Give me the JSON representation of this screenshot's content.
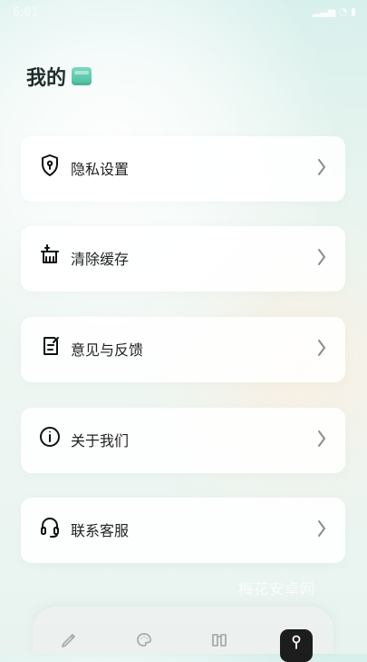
{
  "status_bar": {
    "left_text": "6:01",
    "right_icons": [
      "signal-icon",
      "wifi-icon",
      "battery-icon"
    ]
  },
  "header": {
    "title": "我的"
  },
  "menu": {
    "items": [
      {
        "label": "隐私设置",
        "icon": "shield-icon"
      },
      {
        "label": "清除缓存",
        "icon": "broom-icon"
      },
      {
        "label": "意见与反馈",
        "icon": "feedback-icon"
      },
      {
        "label": "关于我们",
        "icon": "info-icon"
      },
      {
        "label": "联系客服",
        "icon": "headset-icon"
      }
    ]
  },
  "watermark": {
    "text": "梅花安卓网"
  },
  "bottom_nav": {
    "items": [
      {
        "icon": "pencil-icon"
      },
      {
        "icon": "palette-icon"
      },
      {
        "icon": "book-icon"
      },
      {
        "icon": "profile-icon",
        "active": true
      }
    ]
  }
}
